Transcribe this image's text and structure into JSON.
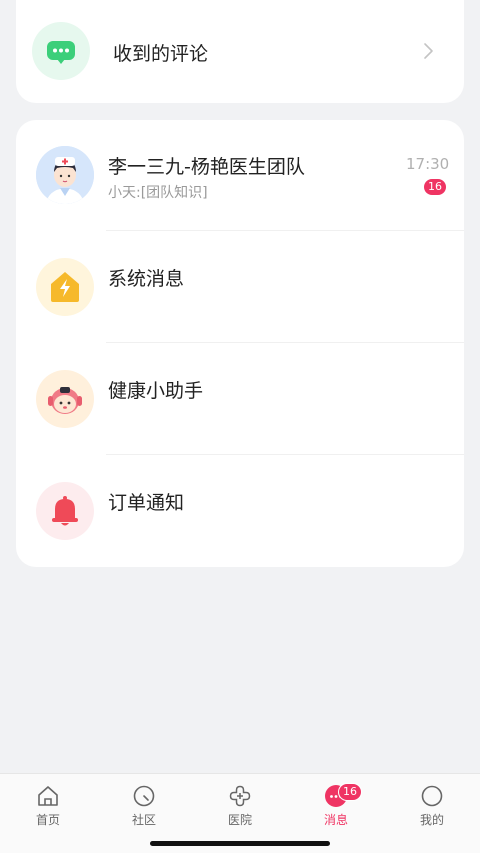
{
  "comments_card": {
    "label": "收到的评论",
    "icon": "chat-bubble-icon",
    "icon_color": "#3ccf7a"
  },
  "messages": [
    {
      "title": "李一三九-杨艳医生团队",
      "subtitle": "小天:[团队知识]",
      "time": "17:30",
      "badge": "16",
      "icon": "doctor-avatar-icon"
    },
    {
      "title": "系统消息",
      "icon": "lightning-house-icon",
      "icon_color": "#f6b92b"
    },
    {
      "title": "健康小助手",
      "icon": "assistant-mascot-icon",
      "icon_color": "#f07a86"
    },
    {
      "title": "订单通知",
      "icon": "bell-icon",
      "icon_color": "#ef4a58"
    }
  ],
  "tabbar": {
    "items": [
      {
        "label": "首页",
        "icon": "home-icon"
      },
      {
        "label": "社区",
        "icon": "community-icon"
      },
      {
        "label": "医院",
        "icon": "hospital-icon"
      },
      {
        "label": "消息",
        "icon": "message-icon",
        "active": true,
        "badge": "16"
      },
      {
        "label": "我的",
        "icon": "profile-icon"
      }
    ]
  },
  "colors": {
    "accent": "#ef3463",
    "background": "#f1f2f4"
  }
}
